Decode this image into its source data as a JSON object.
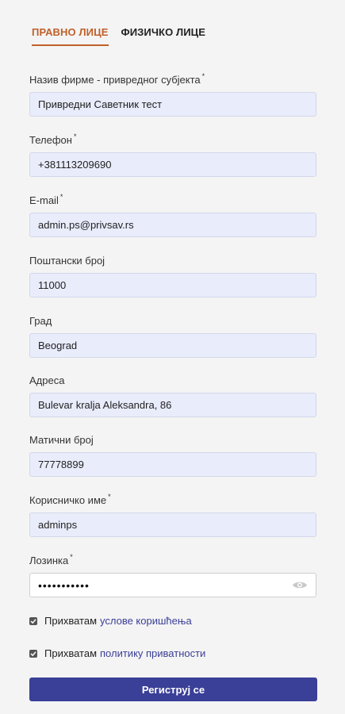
{
  "tabs": [
    {
      "label": "ПРАВНО ЛИЦЕ"
    },
    {
      "label": "ФИЗИЧКО ЛИЦЕ"
    }
  ],
  "fields": {
    "company": {
      "label": "Назив фирме - привредног субјекта",
      "required": "*",
      "value": "Привредни Саветник тест"
    },
    "phone": {
      "label": "Телефон",
      "required": "*",
      "value": "+381113209690"
    },
    "email": {
      "label": "E-mail",
      "required": "*",
      "value": "admin.ps@privsav.rs"
    },
    "postal": {
      "label": "Поштански број",
      "value": "11000"
    },
    "city": {
      "label": "Град",
      "value": "Beograd"
    },
    "address": {
      "label": "Адреса",
      "value": "Bulevar kralja Aleksandra, 86"
    },
    "reg_number": {
      "label": "Матични број",
      "value": "77778899"
    },
    "username": {
      "label": "Корисничко име",
      "required": "*",
      "value": "adminps"
    },
    "password": {
      "label": "Лозинка",
      "required": "*",
      "value": "•••••••••••"
    }
  },
  "terms": {
    "prefix": "Прихватам",
    "link": "услове коришћења"
  },
  "privacy": {
    "prefix": "Прихватам",
    "link": "политику приватности"
  },
  "submit_label": "Региструј се",
  "colors": {
    "accent": "#c0602a",
    "primary": "#3a3f97",
    "input_bg": "#e9ecfb"
  }
}
